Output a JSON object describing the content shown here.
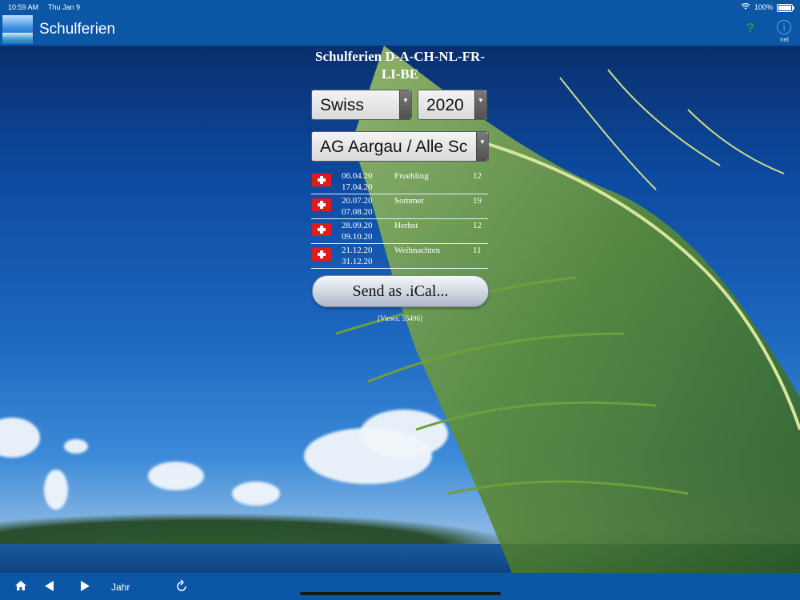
{
  "status_bar": {
    "time": "10:59 AM",
    "date": "Thu Jan 9",
    "battery": "100%"
  },
  "nav": {
    "title": "Schulferien",
    "help": "?",
    "info": "i",
    "info_sub": "net"
  },
  "heading": "Schulferien D-A-CH-NL-FR-LI-BE",
  "selects": {
    "country": "Swiss",
    "year": "2020",
    "region": "AG Aargau / Alle Sc"
  },
  "holidays": [
    {
      "start": "06.04.20",
      "end": "17.04.20",
      "name": "Fruehling",
      "days": "12"
    },
    {
      "start": "20.07.20",
      "end": "07.08.20",
      "name": "Sommer",
      "days": "19"
    },
    {
      "start": "28.09.20",
      "end": "09.10.20",
      "name": "Herbst",
      "days": "12"
    },
    {
      "start": "21.12.20",
      "end": "31.12.20",
      "name": "Weihnachten",
      "days": "11"
    }
  ],
  "ical_button": "Send as .iCal...",
  "views": "[Views: 55496]",
  "toolbar": {
    "jahr": "Jahr"
  },
  "icons": {
    "flag": "swiss-flag-icon",
    "home": "home-icon",
    "prev": "triangle-left-icon",
    "next": "triangle-right-icon",
    "refresh": "refresh-icon",
    "help": "question-icon",
    "info": "info-icon"
  },
  "colors": {
    "bar": "#0b57a6",
    "swiss_red": "#e21a1a",
    "help_green": "#19a34a",
    "info_blue": "#4fa6ff"
  }
}
